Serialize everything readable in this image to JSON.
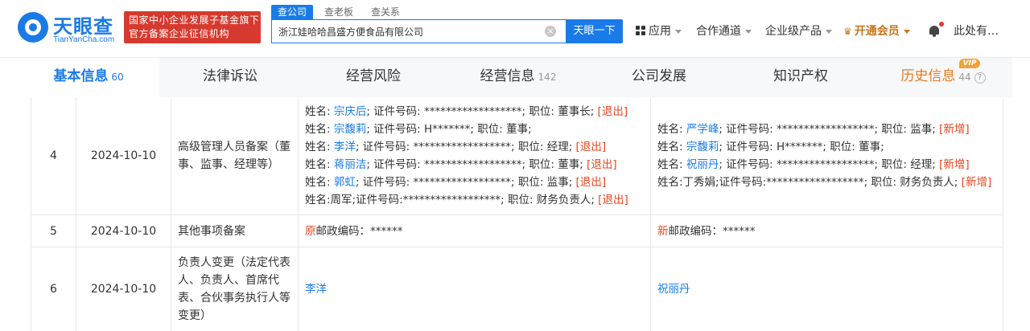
{
  "brand": {
    "logo_cn": "天眼查",
    "logo_en": "TianYanCha.com",
    "badge_line1": "国家中小企业发展子基金旗下",
    "badge_line2": "官方备案企业征信机构"
  },
  "search": {
    "tabs": [
      "查公司",
      "查老板",
      "查关系"
    ],
    "value": "浙江娃哈哈昌盛方便食品有限公司",
    "button": "天眼一下"
  },
  "nav": {
    "apps": "应用",
    "channel": "合作通道",
    "enterprise": "企业级产品",
    "vip": "开通会员",
    "user": "此处有…"
  },
  "tabs": [
    {
      "label": "基本信息",
      "count": "60"
    },
    {
      "label": "法律诉讼",
      "count": ""
    },
    {
      "label": "经营风险",
      "count": ""
    },
    {
      "label": "经营信息",
      "count": "142"
    },
    {
      "label": "公司发展",
      "count": ""
    },
    {
      "label": "知识产权",
      "count": ""
    },
    {
      "label": "历史信息",
      "count": "44",
      "tag": "VIP"
    }
  ],
  "rows": {
    "r4": {
      "num": "4",
      "date": "2024-10-10",
      "item": "高级管理人员备案（董事、监事、经理等）",
      "before": [
        {
          "p": "姓名: ",
          "name": "宗庆后",
          "rest": "; 证件号码: ******************; 职位: 董事长; ",
          "tag": "[退出]"
        },
        {
          "p": "姓名: ",
          "name": "宗馥莉",
          "rest": "; 证件号码: H*******; 职位: 董事;",
          "tag": ""
        },
        {
          "p": "姓名: ",
          "name": "李洋",
          "rest": "; 证件号码: ******************; 职位: 经理; ",
          "tag": "[退出]"
        },
        {
          "p": "姓名: ",
          "name": "蒋丽洁",
          "rest": "; 证件号码: ******************; 职位: 董事; ",
          "tag": "[退出]"
        },
        {
          "p": "姓名: ",
          "name": "郭虹",
          "rest": "; 证件号码: ******************; 职位: 监事; ",
          "tag": "[退出]"
        },
        {
          "p": "姓名:周军;证件号码:******************; 职位: 财务负责人; ",
          "name": "",
          "rest": "",
          "tag": "[退出]"
        }
      ],
      "after": [
        {
          "p": "姓名: ",
          "name": "严学峰",
          "rest": "; 证件号码: ******************; 职位: 监事; ",
          "tag": "[新增]"
        },
        {
          "p": "姓名: ",
          "name": "宗馥莉",
          "rest": "; 证件号码: H*******; 职位: 董事;",
          "tag": ""
        },
        {
          "p": "姓名: ",
          "name": "祝丽丹",
          "rest": "; 证件号码: ******************; 职位: 经理; ",
          "tag": "[新增]"
        },
        {
          "p": "姓名:丁秀娟;证件号码:******************; 职位: 财务负责人; ",
          "name": "",
          "rest": "",
          "tag": "[新增]"
        }
      ]
    },
    "r5": {
      "num": "5",
      "date": "2024-10-10",
      "item": "其他事项备案",
      "before_mark": "原",
      "before_text": "邮政编码：******",
      "after_mark": "新",
      "after_text": "邮政编码：******"
    },
    "r6": {
      "num": "6",
      "date": "2024-10-10",
      "item": "负责人变更（法定代表人、负责人、首席代表、合伙事务执行人等变更）",
      "before": "李洋",
      "after": "祝丽丹"
    }
  }
}
